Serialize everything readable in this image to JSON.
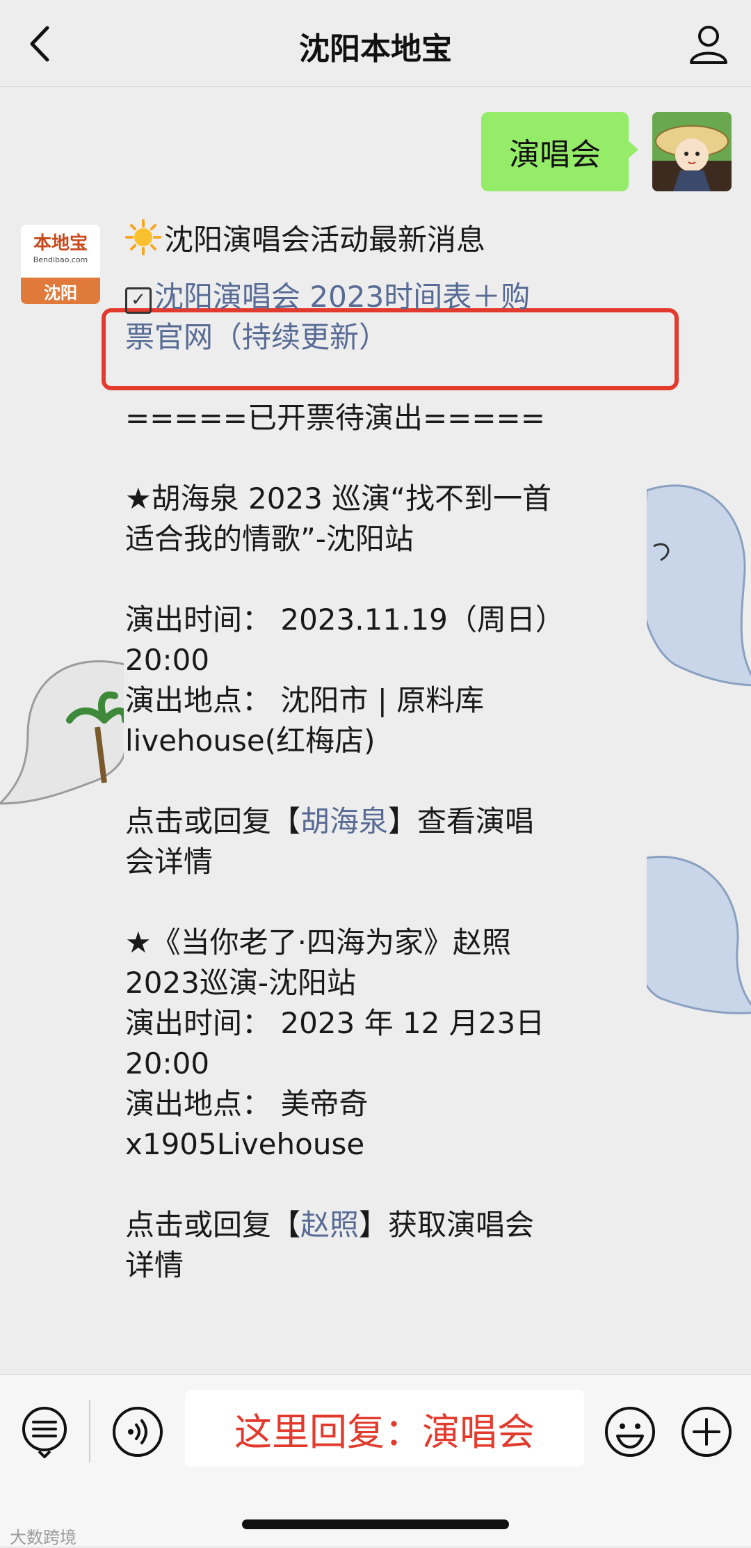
{
  "header": {
    "title": "沈阳本地宝"
  },
  "my_message": {
    "text": "演唱会"
  },
  "bot": {
    "avatar_logo_text": "本地宝",
    "avatar_logo_sub": "Bendibao.com",
    "avatar_city": "沈阳",
    "lines": {
      "l1": "沈阳演唱会活动最新消息",
      "l2": "沈阳演唱会 2023时间表＋购",
      "l3": "票官网（持续更新）",
      "l4": "=====已开票待演出=====",
      "l5": "★胡海泉 2023 巡演“找不到一首",
      "l6": "适合我的情歌”-沈阳站",
      "l7": "演出时间： 2023.11.19（周日）",
      "l8": "20:00",
      "l9": "演出地点： 沈阳市 | 原料库",
      "l10": "livehouse(红梅店)",
      "l11a": "点击或回复【",
      "l11b": "胡海泉",
      "l11c": "】查看演唱",
      "l12": "会详情",
      "l13": "★《当你老了·四海为家》赵照",
      "l14": "2023巡演-沈阳站",
      "l15": "演出时间： 2023 年 12 月23日",
      "l16": "20:00",
      "l17": "演出地点： 美帝奇",
      "l18": "x1905Livehouse",
      "l19a": "点击或回复【",
      "l19b": "赵照",
      "l19c": "】获取演唱会",
      "l20": "详情"
    }
  },
  "input": {
    "reply_text": "这里回复：演唱会"
  },
  "watermark": "大数跨境",
  "colors": {
    "link": "#576b95",
    "highlight_border": "#e23b2e",
    "my_bubble": "#95ec69",
    "background": "#ededed"
  }
}
